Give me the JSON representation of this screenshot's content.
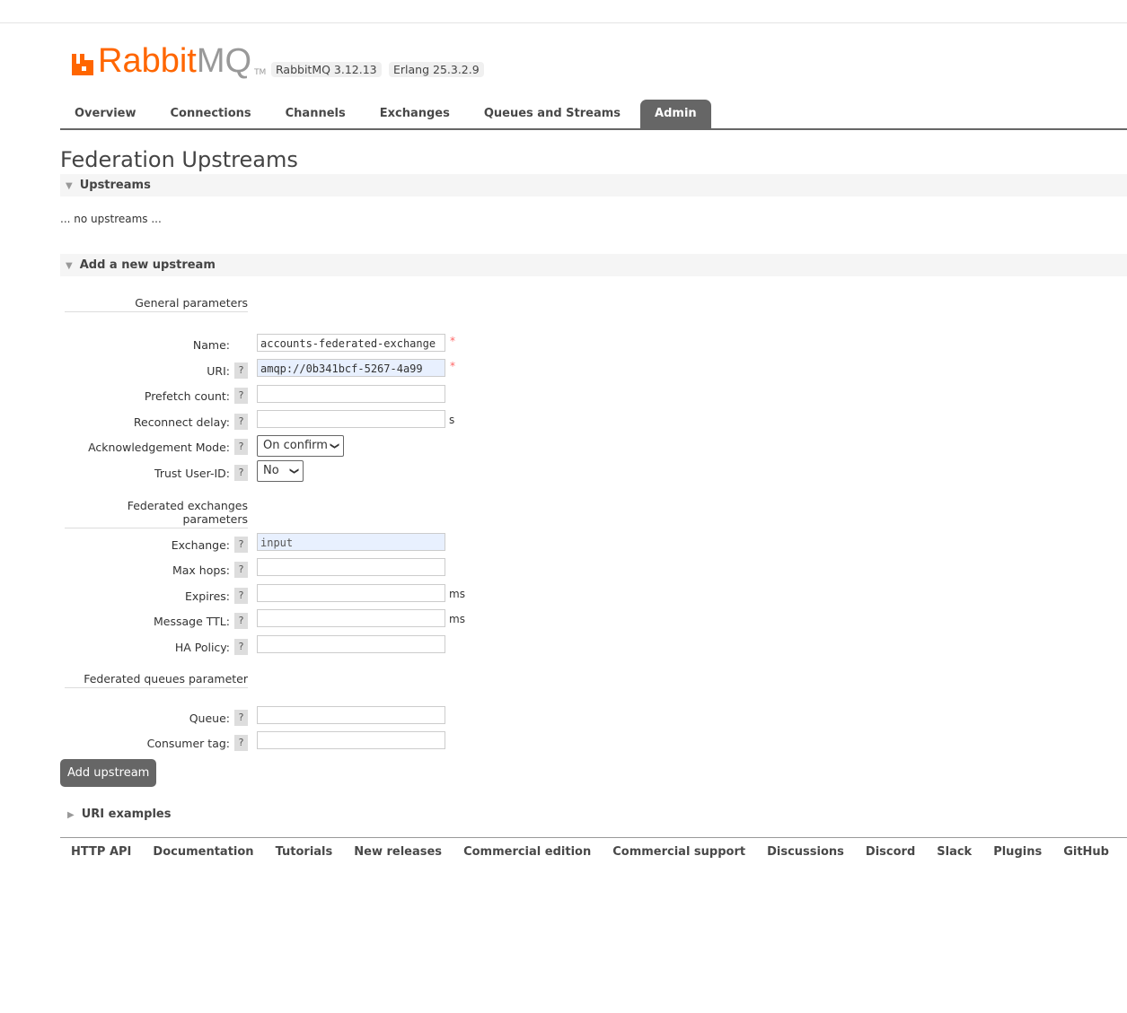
{
  "header": {
    "logo_text": "RabbitMQ",
    "logo_tm": "TM",
    "version": "RabbitMQ 3.12.13",
    "erlang": "Erlang 25.3.2.9"
  },
  "nav": [
    {
      "label": "Overview"
    },
    {
      "label": "Connections"
    },
    {
      "label": "Channels"
    },
    {
      "label": "Exchanges"
    },
    {
      "label": "Queues and Streams"
    },
    {
      "label": "Admin",
      "active": true
    }
  ],
  "page_title": "Federation Upstreams",
  "upstreams": {
    "title": "Upstreams",
    "empty": "... no upstreams ..."
  },
  "add": {
    "title": "Add a new upstream",
    "general": "General parameters",
    "name_label": "Name:",
    "name_value": "accounts-federated-exchange",
    "uri_label": "URI:",
    "uri_value": "amqp://0b341bcf-5267-4a99",
    "prefetch_label": "Prefetch count:",
    "reconnect_label": "Reconnect delay:",
    "reconnect_unit": "s",
    "ack_label": "Acknowledgement Mode:",
    "ack_value": "On confirm",
    "trust_label": "Trust User-ID:",
    "trust_value": "No",
    "fed_ex": "Federated exchanges parameters",
    "exchange_label": "Exchange:",
    "exchange_placeholder": "input",
    "maxhops_label": "Max hops:",
    "expires_label": "Expires:",
    "expires_unit": "ms",
    "ttl_label": "Message TTL:",
    "ttl_unit": "ms",
    "ha_label": "HA Policy:",
    "fed_q": "Federated queues parameter",
    "queue_label": "Queue:",
    "ctag_label": "Consumer tag:",
    "help": "?",
    "required": "*",
    "submit": "Add upstream"
  },
  "uri_examples": "URI examples",
  "footer": [
    "HTTP API",
    "Documentation",
    "Tutorials",
    "New releases",
    "Commercial edition",
    "Commercial support",
    "Discussions",
    "Discord",
    "Slack",
    "Plugins",
    "GitHub"
  ],
  "colors": {
    "brand": "#ff6600",
    "tab_active": "#666666"
  }
}
